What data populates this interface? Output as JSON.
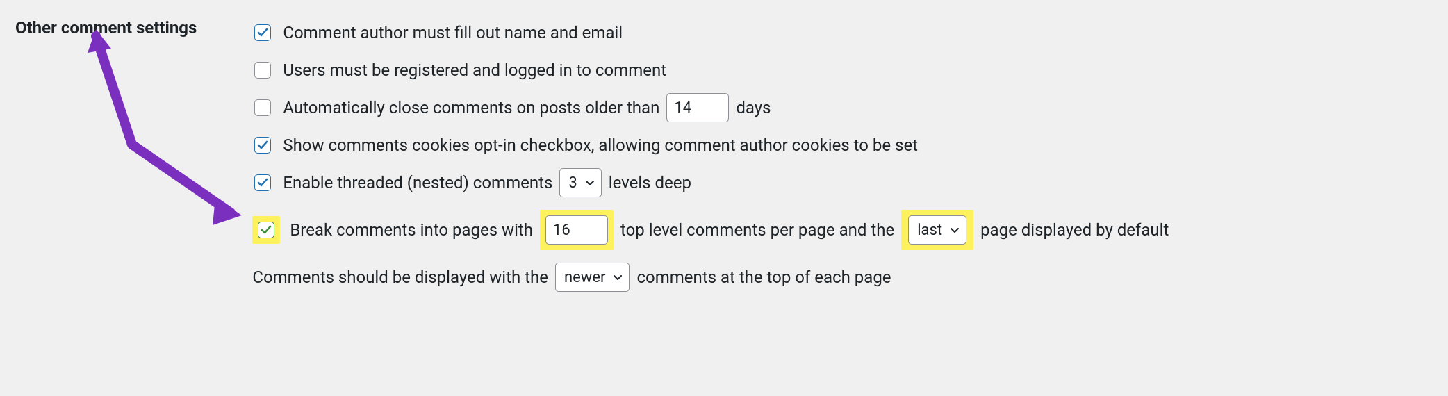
{
  "section": {
    "title": "Other comment settings"
  },
  "settings": {
    "require_name_email": {
      "label": "Comment author must fill out name and email",
      "checked": true
    },
    "require_registered": {
      "label": "Users must be registered and logged in to comment",
      "checked": false
    },
    "auto_close": {
      "label_pre": "Automatically close comments on posts older than",
      "days_value": "14",
      "label_post": "days",
      "checked": false
    },
    "cookies_optin": {
      "label": "Show comments cookies opt-in checkbox, allowing comment author cookies to be set",
      "checked": true
    },
    "threaded": {
      "label_pre": "Enable threaded (nested) comments",
      "levels_value": "3",
      "label_post": "levels deep",
      "checked": true
    },
    "pagination": {
      "label_pre": "Break comments into pages with",
      "per_page_value": "16",
      "label_mid": "top level comments per page and the",
      "default_page_value": "last",
      "label_post": "page displayed by default",
      "checked": true
    },
    "order": {
      "label_pre": "Comments should be displayed with the",
      "order_value": "newer",
      "label_post": "comments at the top of each page"
    }
  }
}
